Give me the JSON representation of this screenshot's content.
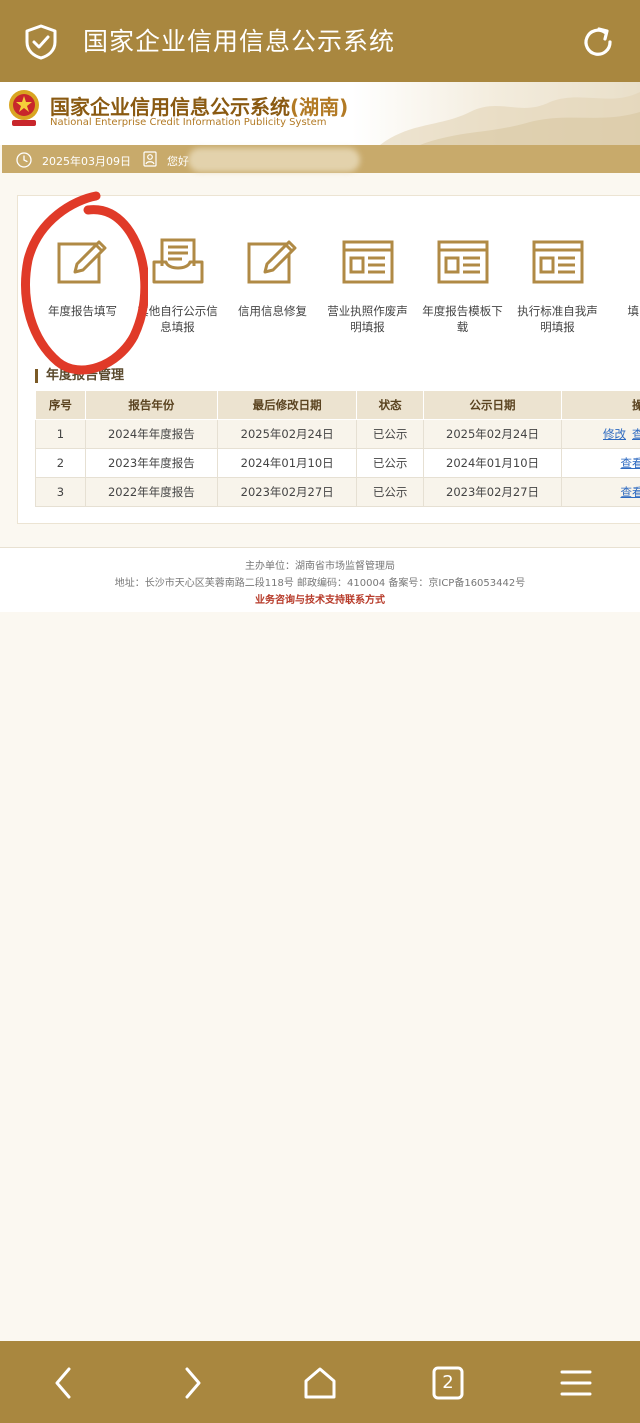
{
  "browser": {
    "title": "国家企业信用信息公示系统",
    "tab_count": "2"
  },
  "site": {
    "title": "国家企业信用信息公示系统",
    "province": "(湖南)",
    "subtitle": "National Enterprise Credit Information Publicity System"
  },
  "infobar": {
    "date": "2025年03月09日",
    "greeting": "您好"
  },
  "menu": [
    {
      "label": "年度报告填写",
      "icon": "edit-icon"
    },
    {
      "label": "其他自行公示信息填报",
      "icon": "inbox-icon"
    },
    {
      "label": "信用信息修复",
      "icon": "edit-icon"
    },
    {
      "label": "营业执照作废声明填报",
      "icon": "form-icon"
    },
    {
      "label": "年度报告模板下载",
      "icon": "form-icon"
    },
    {
      "label": "执行标准自我声明填报",
      "icon": "form-icon"
    },
    {
      "label": "填",
      "icon": "partial-icon"
    }
  ],
  "section": {
    "title": "年度报告管理"
  },
  "table": {
    "headers": [
      "序号",
      "报告年份",
      "最后修改日期",
      "状态",
      "公示日期",
      "操作"
    ],
    "rows": [
      {
        "index": "1",
        "year": "2024年年度报告",
        "modified": "2025年02月24日",
        "status": "已公示",
        "published": "2025年02月24日",
        "op1": "修改",
        "op2": "查看"
      },
      {
        "index": "2",
        "year": "2023年年度报告",
        "modified": "2024年01月10日",
        "status": "已公示",
        "published": "2024年01月10日",
        "op1": "查看或",
        "op2": ""
      },
      {
        "index": "3",
        "year": "2022年年度报告",
        "modified": "2023年02月27日",
        "status": "已公示",
        "published": "2023年02月27日",
        "op1": "查看或",
        "op2": ""
      }
    ]
  },
  "footer": {
    "sponsor": "主办单位：湖南省市场监督管理局",
    "address": "地址：长沙市天心区芙蓉南路二段118号 邮政编码：410004 备案号：京ICP备16053442号",
    "contact": "业务咨询与技术支持联系方式"
  },
  "colors": {
    "brand": "#a9873f",
    "accent": "#8a5a12",
    "link": "#2f6bc1",
    "annotation": "#e03a28"
  }
}
